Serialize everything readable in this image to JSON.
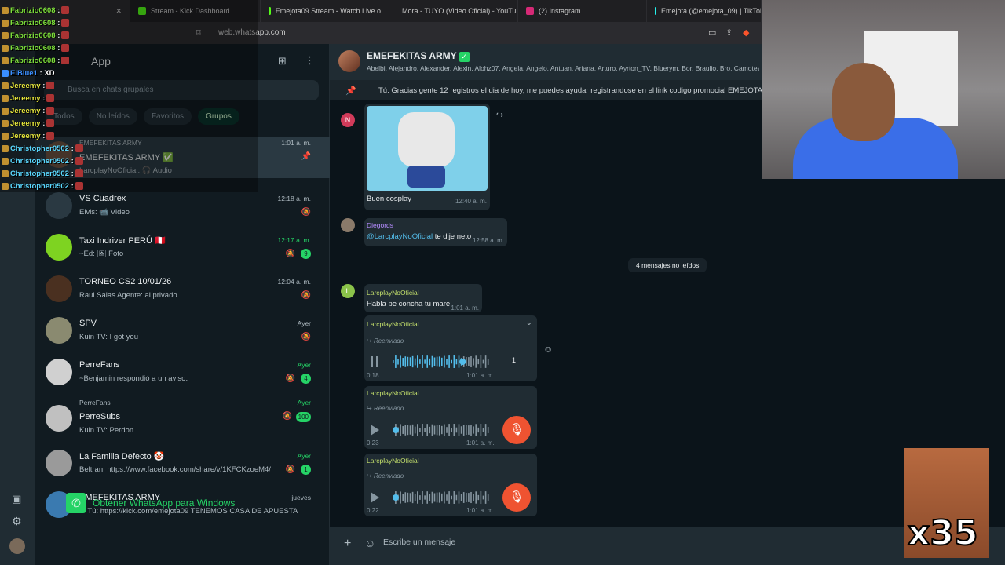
{
  "browser": {
    "tabs": [
      {
        "title": "",
        "active": true
      },
      {
        "title": "Stream - Kick Dashboard"
      },
      {
        "title": "Emejota09 Stream - Watch Live o"
      },
      {
        "title": "Mora - TUYO (Video Oficial) - YouTub"
      },
      {
        "title": "(2) Instagram"
      },
      {
        "title": "Emejota (@emejota_09) | TikTok"
      }
    ],
    "url": "web.whatsapp.com"
  },
  "overlay_chat": [
    {
      "user": "Fabrizio0608",
      "color": "#7ddf3a",
      "msg": ""
    },
    {
      "user": "Fabrizio0608",
      "color": "#7ddf3a",
      "msg": ""
    },
    {
      "user": "Fabrizio0608",
      "color": "#7ddf3a",
      "msg": ""
    },
    {
      "user": "Fabrizio0608",
      "color": "#7ddf3a",
      "msg": ""
    },
    {
      "user": "Fabrizio0608",
      "color": "#7ddf3a",
      "msg": ""
    },
    {
      "user": "ElBlue1",
      "color": "#3a8fff",
      "msg": "XD"
    },
    {
      "user": "Jereemy",
      "color": "#e6e63a",
      "msg": ""
    },
    {
      "user": "Jereemy",
      "color": "#e6e63a",
      "msg": ""
    },
    {
      "user": "Jereemy",
      "color": "#e6e63a",
      "msg": ""
    },
    {
      "user": "Jereemy",
      "color": "#e6e63a",
      "msg": ""
    },
    {
      "user": "Jereemy",
      "color": "#e6e63a",
      "msg": ""
    },
    {
      "user": "Christopher0502",
      "color": "#5ad8ff",
      "msg": ""
    },
    {
      "user": "Christopher0502",
      "color": "#5ad8ff",
      "msg": ""
    },
    {
      "user": "Christopher0502",
      "color": "#5ad8ff",
      "msg": ""
    },
    {
      "user": "Christopher0502",
      "color": "#5ad8ff",
      "msg": ""
    }
  ],
  "sidebar": {
    "title": "App",
    "search_placeholder": "Busca en chats grupales",
    "filters": [
      "Todos",
      "No leídos",
      "Favoritos",
      "Grupos"
    ],
    "chats": [
      {
        "name": "EMEFEKITAS ARMY ✅",
        "sub": "EMEFEKITAS ARMY",
        "preview": "LarcplayNoOficial:  🎧 Audio",
        "time": "1:01 a. m.",
        "pinned": true
      },
      {
        "name": "VS Cuadrex",
        "preview": "Elvis: 📹 Video",
        "time": "12:18 a. m.",
        "mute": true
      },
      {
        "name": "Taxi Indriver PERÚ 🇵🇪",
        "preview": "~Ed: 🖼 Foto",
        "time": "12:17 a. m.",
        "time_green": true,
        "badge": "9",
        "mute": true
      },
      {
        "name": "TORNEO CS2 10/01/26",
        "preview": "Raul Salas Agente: al privado",
        "time": "12:04 a. m.",
        "mute": true
      },
      {
        "name": "SPV",
        "preview": "Kuin TV: I got you",
        "time": "Ayer",
        "mute": true
      },
      {
        "name": "PerreFans",
        "preview": "~Benjamin respondió a un aviso.",
        "time": "Ayer",
        "time_green": true,
        "badge": "4",
        "mute": true
      },
      {
        "name": "PerreSubs",
        "sub": "PerreFans",
        "preview": "Kuin TV: Perdon",
        "time": "Ayer",
        "time_green": true,
        "badge": "100",
        "mute": true
      },
      {
        "name": "La Familia Defecto 🤡",
        "preview": "Beltran: https://www.facebook.com/share/v/1KFCKzoeM4/",
        "time": "Ayer",
        "time_green": true,
        "badge": "1",
        "mute": true
      },
      {
        "name": "EMEFEKITAS ARMY",
        "preview": "✓ Tú: https://kick.com/emejota09 TENEMOS CASA DE APUESTA !!! ...",
        "time": "jueves"
      }
    ],
    "get_whatsapp": "Obtener WhatsApp para Windows"
  },
  "conversation": {
    "group_name": "EMEFEKITAS ARMY",
    "members": "Abelbi, Alejandro, Alexander, Alexin, Alohz07, Angela, Angelo, Antuan, Ariana, Arturo, Ayrton_TV, Bluerym, Bor, Braulio, Bro, Camotezz",
    "pinned_message": "Tú: Gracias gente 12 registros el dia de hoy,  me puedes ayudar registrandose en el link codigo promocial EMEJOTA https:",
    "messages": [
      {
        "type": "image",
        "avatar_letter": "N",
        "caption": "Buen cosplay",
        "time": "12:40 a. m."
      },
      {
        "type": "text",
        "sender": "Diegords",
        "mention": "@LarcplayNoOficial",
        "text": " te dije neto",
        "time": "12:58 a. m."
      },
      {
        "type": "text",
        "sender": "LarcplayNoOficial",
        "avatar_letter": "L",
        "text": "Habla pe concha tu mare",
        "time": "1:01 a. m."
      },
      {
        "type": "audio",
        "sender": "LarcplayNoOficial",
        "forwarded": "Reenviado",
        "duration": "0:18",
        "speed": "1",
        "time": "1:01 a. m.",
        "progress": 0.72
      },
      {
        "type": "audio",
        "sender": "LarcplayNoOficial",
        "forwarded": "Reenviado",
        "duration": "0:23",
        "time": "1:01 a. m.",
        "progress": 0
      },
      {
        "type": "audio",
        "sender": "LarcplayNoOficial",
        "forwarded": "Reenviado",
        "duration": "0:22",
        "time": "1:01 a. m.",
        "progress": 0
      }
    ],
    "unread_divider": "4 mensajes no leídos",
    "compose_placeholder": "Escribe un mensaje"
  },
  "stream_overlay": {
    "counter": "x35"
  }
}
